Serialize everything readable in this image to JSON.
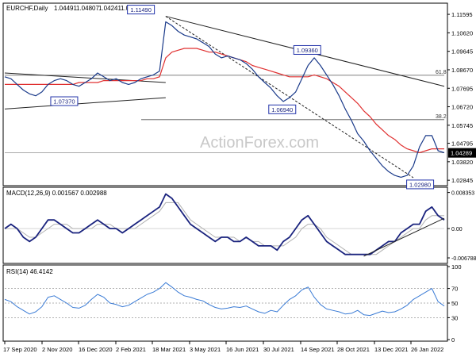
{
  "chart_data": [
    {
      "panel": "price",
      "type": "ohlc",
      "title": "EURCHF,Daily",
      "ohlc_values": [
        "1.04491",
        "1.04807",
        "1.04241",
        "1.04289"
      ],
      "watermark": "ActionForex.com",
      "ylim": [
        1.026,
        1.121
      ],
      "y_ticks": [
        "1.11595",
        "1.10620",
        "1.09645",
        "1.08670",
        "1.07695",
        "1.06720",
        "1.05745",
        "1.04795",
        "1.03820",
        "1.02845"
      ],
      "current_price_label": "1.04289",
      "current_price": 1.04289,
      "series": [
        {
          "name": "price",
          "role": "price",
          "color": "#1a3a8a",
          "values": [
            1.083,
            1.082,
            1.079,
            1.076,
            1.074,
            1.073,
            1.075,
            1.079,
            1.081,
            1.082,
            1.081,
            1.079,
            1.078,
            1.08,
            1.082,
            1.085,
            1.083,
            1.081,
            1.082,
            1.08,
            1.079,
            1.08,
            1.082,
            1.083,
            1.084,
            1.086,
            1.112,
            1.11,
            1.107,
            1.105,
            1.104,
            1.103,
            1.101,
            1.099,
            1.095,
            1.093,
            1.094,
            1.093,
            1.092,
            1.09,
            1.087,
            1.083,
            1.08,
            1.077,
            1.073,
            1.07,
            1.072,
            1.075,
            1.082,
            1.089,
            1.093,
            1.089,
            1.084,
            1.079,
            1.073,
            1.066,
            1.06,
            1.053,
            1.049,
            1.044,
            1.04,
            1.036,
            1.033,
            1.031,
            1.03,
            1.031,
            1.036,
            1.046,
            1.052,
            1.052,
            1.044,
            1.043
          ]
        },
        {
          "name": "moving-average",
          "role": "ma",
          "color": "#e03030",
          "values": [
            1.079,
            1.079,
            1.079,
            1.079,
            1.079,
            1.079,
            1.079,
            1.079,
            1.079,
            1.079,
            1.079,
            1.079,
            1.08,
            1.08,
            1.08,
            1.08,
            1.081,
            1.081,
            1.081,
            1.081,
            1.081,
            1.081,
            1.081,
            1.082,
            1.082,
            1.083,
            1.093,
            1.096,
            1.097,
            1.098,
            1.098,
            1.098,
            1.097,
            1.096,
            1.096,
            1.095,
            1.094,
            1.093,
            1.092,
            1.091,
            1.089,
            1.088,
            1.087,
            1.086,
            1.085,
            1.084,
            1.083,
            1.083,
            1.083,
            1.083,
            1.084,
            1.083,
            1.082,
            1.08,
            1.078,
            1.075,
            1.072,
            1.069,
            1.065,
            1.062,
            1.058,
            1.055,
            1.052,
            1.05,
            1.047,
            1.045,
            1.044,
            1.043,
            1.044,
            1.045,
            1.045,
            1.045
          ]
        }
      ],
      "annotations": [
        {
          "label": "1.11490",
          "date": "2021-02-22",
          "price": 1.1149
        },
        {
          "label": "1.07370",
          "date": "2020-11-25",
          "price": 1.0737
        },
        {
          "label": "1.09360",
          "date": "2021-09-03",
          "price": 1.0936
        },
        {
          "label": "1.06940",
          "date": "2021-08-05",
          "price": 1.0694
        },
        {
          "label": "1.02980",
          "date": "2022-01-12",
          "price": 1.0298
        }
      ],
      "levels": [
        {
          "label": "61.8",
          "price": 1.0838
        },
        {
          "label": "38.2",
          "price": 1.0604
        }
      ]
    },
    {
      "panel": "macd",
      "type": "line",
      "title": "MACD(12,26,9) 0.001567 0.002988",
      "ylim": [
        -0.0077,
        0.0092
      ],
      "y_ticks": [
        "0.008353",
        "0.00",
        "-0.006788"
      ],
      "series": [
        {
          "name": "macd",
          "color": "#1a237e",
          "values": [
            0.0,
            0.001,
            0.0,
            -0.002,
            -0.003,
            -0.002,
            0.0,
            0.002,
            0.002,
            0.001,
            0.0,
            -0.001,
            -0.001,
            0.0,
            0.001,
            0.002,
            0.001,
            0.0,
            0.0,
            -0.001,
            0.0,
            0.001,
            0.002,
            0.003,
            0.004,
            0.005,
            0.008,
            0.007,
            0.005,
            0.003,
            0.001,
            0.0,
            -0.001,
            -0.002,
            -0.003,
            -0.002,
            -0.002,
            -0.003,
            -0.003,
            -0.002,
            -0.003,
            -0.004,
            -0.004,
            -0.004,
            -0.005,
            -0.003,
            -0.002,
            0.0,
            0.002,
            0.003,
            0.001,
            -0.001,
            -0.003,
            -0.004,
            -0.005,
            -0.006,
            -0.006,
            -0.006,
            -0.006,
            -0.006,
            -0.005,
            -0.004,
            -0.003,
            -0.003,
            -0.001,
            0.0,
            0.001,
            0.001,
            0.004,
            0.005,
            0.003,
            0.002
          ]
        },
        {
          "name": "signal",
          "color": "#b0b0b0",
          "values": [
            0.0,
            0.0,
            0.0,
            -0.001,
            -0.002,
            -0.002,
            -0.001,
            0.0,
            0.001,
            0.001,
            0.001,
            0.0,
            0.0,
            0.0,
            0.0,
            0.001,
            0.001,
            0.001,
            0.0,
            0.0,
            0.0,
            0.0,
            0.001,
            0.002,
            0.003,
            0.004,
            0.006,
            0.006,
            0.006,
            0.004,
            0.002,
            0.001,
            0.0,
            -0.001,
            -0.002,
            -0.002,
            -0.002,
            -0.002,
            -0.003,
            -0.002,
            -0.003,
            -0.003,
            -0.004,
            -0.004,
            -0.004,
            -0.004,
            -0.003,
            -0.002,
            0.0,
            0.001,
            0.001,
            0.0,
            -0.002,
            -0.003,
            -0.004,
            -0.005,
            -0.006,
            -0.006,
            -0.006,
            -0.006,
            -0.006,
            -0.005,
            -0.004,
            -0.003,
            -0.002,
            -0.001,
            0.0,
            0.0,
            0.002,
            0.003,
            0.003,
            0.003
          ]
        }
      ]
    },
    {
      "panel": "rsi",
      "type": "line",
      "title": "RSI(14) 46.4142",
      "ylim": [
        0,
        100
      ],
      "y_ticks": [
        "100",
        "70",
        "50",
        "30",
        "0"
      ],
      "levels": [
        70,
        50,
        30
      ],
      "series": [
        {
          "name": "rsi",
          "color": "#3a7bd5",
          "values": [
            55,
            52,
            45,
            40,
            35,
            38,
            45,
            58,
            60,
            55,
            50,
            44,
            43,
            47,
            55,
            62,
            58,
            50,
            48,
            45,
            47,
            52,
            57,
            62,
            65,
            70,
            78,
            72,
            65,
            60,
            58,
            55,
            53,
            48,
            44,
            42,
            43,
            45,
            44,
            46,
            42,
            38,
            36,
            40,
            38,
            47,
            55,
            60,
            68,
            72,
            58,
            48,
            42,
            40,
            38,
            35,
            36,
            40,
            34,
            33,
            36,
            39,
            37,
            38,
            42,
            47,
            55,
            60,
            65,
            70,
            52,
            46
          ]
        }
      ]
    }
  ],
  "x_axis": {
    "tick_labels": [
      "17 Sep 2020",
      "2 Nov 2020",
      "16 Dec 2020",
      "2 Feb 2021",
      "18 Mar 2021",
      "3 May 2021",
      "16 Jun 2021",
      "30 Jul 2021",
      "14 Sep 2021",
      "28 Oct 2021",
      "13 Dec 2021",
      "26 Jan 2022"
    ]
  }
}
